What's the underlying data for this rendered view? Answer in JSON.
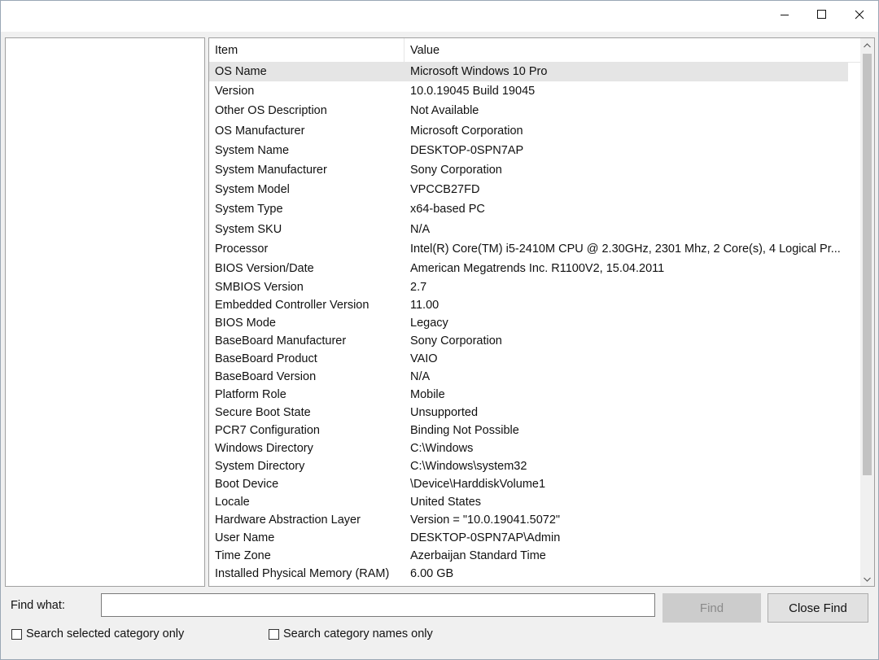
{
  "window": {
    "min_icon": "minimize-icon",
    "max_icon": "maximize-icon",
    "close_icon": "close-icon"
  },
  "table": {
    "columns": [
      "Item",
      "Value"
    ],
    "rows": [
      {
        "item": "OS Name",
        "value": "Microsoft Windows 10 Pro",
        "selected": true
      },
      {
        "item": "Version",
        "value": "10.0.19045 Build 19045"
      },
      {
        "item": "Other OS Description",
        "value": "Not Available"
      },
      {
        "item": "OS Manufacturer",
        "value": "Microsoft Corporation"
      },
      {
        "item": "System Name",
        "value": "DESKTOP-0SPN7AP"
      },
      {
        "item": "System Manufacturer",
        "value": "Sony Corporation"
      },
      {
        "item": "System Model",
        "value": "VPCCB27FD"
      },
      {
        "item": "System Type",
        "value": "x64-based PC"
      },
      {
        "item": "System SKU",
        "value": "N/A"
      },
      {
        "item": "Processor",
        "value": "Intel(R) Core(TM) i5-2410M CPU @ 2.30GHz, 2301 Mhz, 2 Core(s), 4 Logical Pr..."
      },
      {
        "item": "BIOS Version/Date",
        "value": "American Megatrends Inc. R1100V2, 15.04.2011"
      },
      {
        "item": "SMBIOS Version",
        "value": "2.7"
      },
      {
        "item": "Embedded Controller Version",
        "value": "11.00"
      },
      {
        "item": "BIOS Mode",
        "value": "Legacy"
      },
      {
        "item": "BaseBoard Manufacturer",
        "value": "Sony Corporation"
      },
      {
        "item": "BaseBoard Product",
        "value": "VAIO"
      },
      {
        "item": "BaseBoard Version",
        "value": "N/A"
      },
      {
        "item": "Platform Role",
        "value": "Mobile"
      },
      {
        "item": "Secure Boot State",
        "value": "Unsupported"
      },
      {
        "item": "PCR7 Configuration",
        "value": "Binding Not Possible"
      },
      {
        "item": "Windows Directory",
        "value": "C:\\Windows"
      },
      {
        "item": "System Directory",
        "value": "C:\\Windows\\system32"
      },
      {
        "item": "Boot Device",
        "value": "\\Device\\HarddiskVolume1"
      },
      {
        "item": "Locale",
        "value": "United States"
      },
      {
        "item": "Hardware Abstraction Layer",
        "value": "Version = \"10.0.19041.5072\""
      },
      {
        "item": "User Name",
        "value": "DESKTOP-0SPN7AP\\Admin"
      },
      {
        "item": "Time Zone",
        "value": "Azerbaijan Standard Time"
      },
      {
        "item": "Installed Physical Memory (RAM)",
        "value": "6.00 GB"
      }
    ]
  },
  "find": {
    "label": "Find what:",
    "input_value": "",
    "find_button": "Find",
    "close_find_button": "Close Find",
    "checkbox_selected_category": "Search selected category only",
    "checkbox_category_names": "Search category names only"
  },
  "colors": {
    "selected_row": "#e5e5e5",
    "window_bg": "#f0f0f0"
  }
}
